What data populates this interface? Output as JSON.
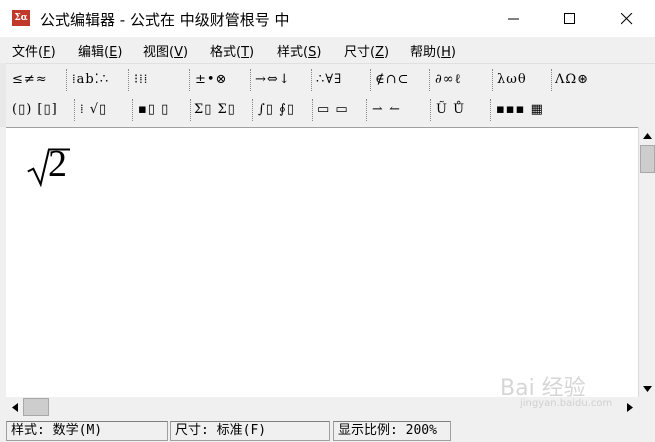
{
  "window": {
    "app_icon_text": "Σα",
    "title": "公式编辑器 - 公式在 中级财管根号 中"
  },
  "menubar": {
    "items": [
      {
        "label": "文件",
        "key": "F"
      },
      {
        "label": "编辑",
        "key": "E"
      },
      {
        "label": "视图",
        "key": "V"
      },
      {
        "label": "格式",
        "key": "T"
      },
      {
        "label": "样式",
        "key": "S"
      },
      {
        "label": "尺寸",
        "key": "Z"
      },
      {
        "label": "帮助",
        "key": "H"
      }
    ]
  },
  "toolbar": {
    "row1": [
      "≤≠≈",
      "⁞ab⁚∴",
      "⁝⁞⁞",
      "±•⊗",
      "→⇔↓",
      "∴∀∃",
      "∉∩⊂",
      "∂∞ℓ",
      "λωθ",
      "ΛΩ⊛"
    ],
    "row2": [
      "(▯) [▯]",
      "⁞ √▯",
      "▪▯ ▯",
      "Σ▯ Σ▯",
      "∫▯ ∮▯",
      "▭ ▭",
      "⇀ ↼",
      "Ũ Ů",
      "▪▪▪ ▦"
    ]
  },
  "editor": {
    "formula_radicand": "2"
  },
  "statusbar": {
    "style": "样式: 数学(M)",
    "size": "尺寸: 标准(F)",
    "zoom": "显示比例: 200%"
  },
  "watermark": {
    "text": "Bai 经验",
    "sub": "jingyan.baidu.com"
  }
}
